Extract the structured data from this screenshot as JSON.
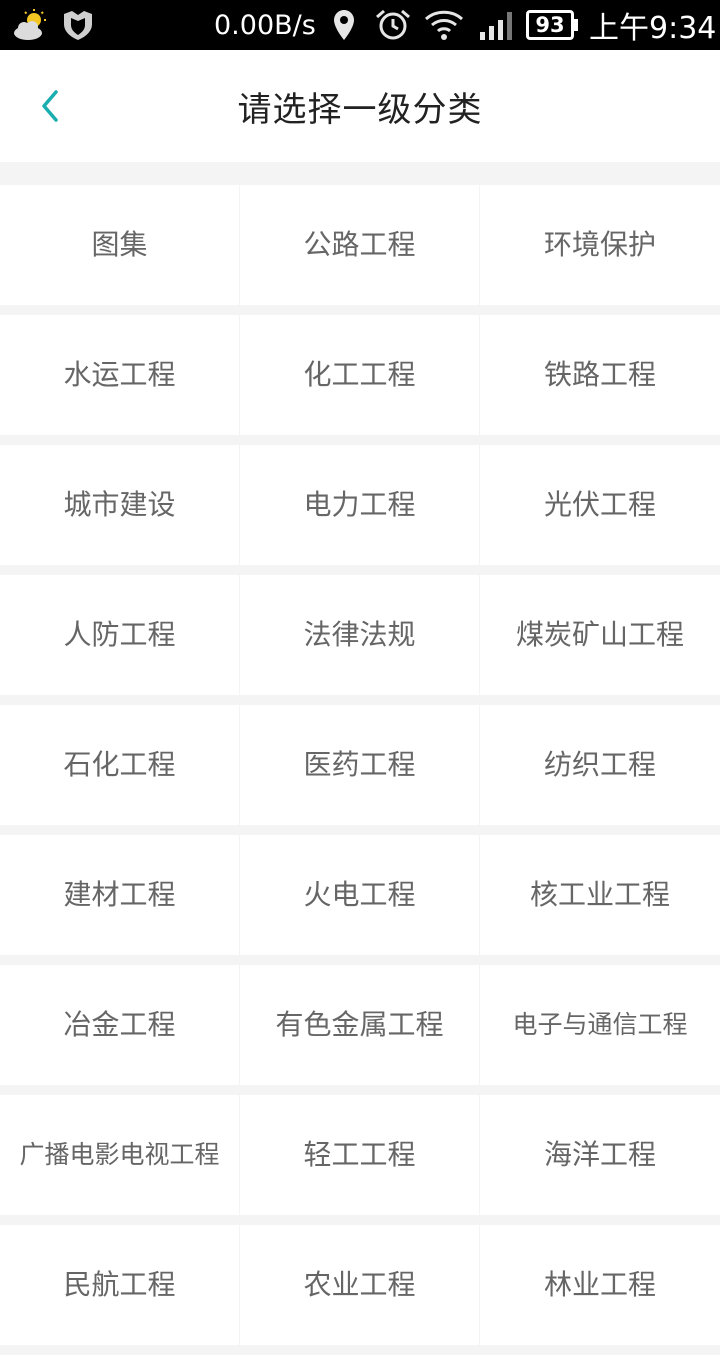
{
  "status_bar": {
    "net_speed": "0.00B/s",
    "battery": "93",
    "time": "上午9:34"
  },
  "header": {
    "title": "请选择一级分类",
    "accent_color": "#1aaeb0"
  },
  "categories": [
    [
      "图集",
      "公路工程",
      "环境保护"
    ],
    [
      "水运工程",
      "化工工程",
      "铁路工程"
    ],
    [
      "城市建设",
      "电力工程",
      "光伏工程"
    ],
    [
      "人防工程",
      "法律法规",
      "煤炭矿山工程"
    ],
    [
      "石化工程",
      "医药工程",
      "纺织工程"
    ],
    [
      "建材工程",
      "火电工程",
      "核工业工程"
    ],
    [
      "冶金工程",
      "有色金属工程",
      "电子与通信工程"
    ],
    [
      "广播电影电视工程",
      "轻工工程",
      "海洋工程"
    ],
    [
      "民航工程",
      "农业工程",
      "林业工程"
    ]
  ]
}
